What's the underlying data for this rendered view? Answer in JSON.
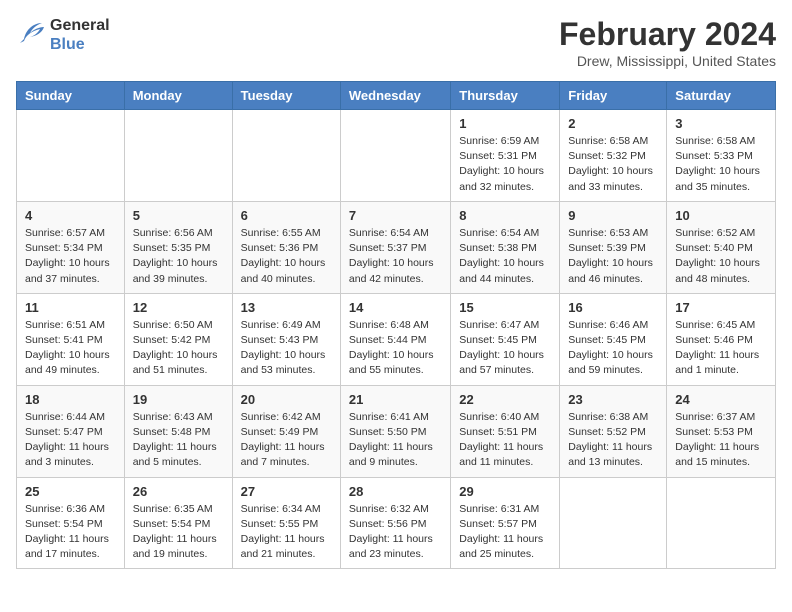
{
  "header": {
    "logo": {
      "general": "General",
      "blue": "Blue"
    },
    "title": "February 2024",
    "location": "Drew, Mississippi, United States"
  },
  "days_of_week": [
    "Sunday",
    "Monday",
    "Tuesday",
    "Wednesday",
    "Thursday",
    "Friday",
    "Saturday"
  ],
  "weeks": [
    [
      null,
      null,
      null,
      null,
      {
        "day": "1",
        "sunrise": "Sunrise: 6:59 AM",
        "sunset": "Sunset: 5:31 PM",
        "daylight": "Daylight: 10 hours and 32 minutes."
      },
      {
        "day": "2",
        "sunrise": "Sunrise: 6:58 AM",
        "sunset": "Sunset: 5:32 PM",
        "daylight": "Daylight: 10 hours and 33 minutes."
      },
      {
        "day": "3",
        "sunrise": "Sunrise: 6:58 AM",
        "sunset": "Sunset: 5:33 PM",
        "daylight": "Daylight: 10 hours and 35 minutes."
      }
    ],
    [
      {
        "day": "4",
        "sunrise": "Sunrise: 6:57 AM",
        "sunset": "Sunset: 5:34 PM",
        "daylight": "Daylight: 10 hours and 37 minutes."
      },
      {
        "day": "5",
        "sunrise": "Sunrise: 6:56 AM",
        "sunset": "Sunset: 5:35 PM",
        "daylight": "Daylight: 10 hours and 39 minutes."
      },
      {
        "day": "6",
        "sunrise": "Sunrise: 6:55 AM",
        "sunset": "Sunset: 5:36 PM",
        "daylight": "Daylight: 10 hours and 40 minutes."
      },
      {
        "day": "7",
        "sunrise": "Sunrise: 6:54 AM",
        "sunset": "Sunset: 5:37 PM",
        "daylight": "Daylight: 10 hours and 42 minutes."
      },
      {
        "day": "8",
        "sunrise": "Sunrise: 6:54 AM",
        "sunset": "Sunset: 5:38 PM",
        "daylight": "Daylight: 10 hours and 44 minutes."
      },
      {
        "day": "9",
        "sunrise": "Sunrise: 6:53 AM",
        "sunset": "Sunset: 5:39 PM",
        "daylight": "Daylight: 10 hours and 46 minutes."
      },
      {
        "day": "10",
        "sunrise": "Sunrise: 6:52 AM",
        "sunset": "Sunset: 5:40 PM",
        "daylight": "Daylight: 10 hours and 48 minutes."
      }
    ],
    [
      {
        "day": "11",
        "sunrise": "Sunrise: 6:51 AM",
        "sunset": "Sunset: 5:41 PM",
        "daylight": "Daylight: 10 hours and 49 minutes."
      },
      {
        "day": "12",
        "sunrise": "Sunrise: 6:50 AM",
        "sunset": "Sunset: 5:42 PM",
        "daylight": "Daylight: 10 hours and 51 minutes."
      },
      {
        "day": "13",
        "sunrise": "Sunrise: 6:49 AM",
        "sunset": "Sunset: 5:43 PM",
        "daylight": "Daylight: 10 hours and 53 minutes."
      },
      {
        "day": "14",
        "sunrise": "Sunrise: 6:48 AM",
        "sunset": "Sunset: 5:44 PM",
        "daylight": "Daylight: 10 hours and 55 minutes."
      },
      {
        "day": "15",
        "sunrise": "Sunrise: 6:47 AM",
        "sunset": "Sunset: 5:45 PM",
        "daylight": "Daylight: 10 hours and 57 minutes."
      },
      {
        "day": "16",
        "sunrise": "Sunrise: 6:46 AM",
        "sunset": "Sunset: 5:45 PM",
        "daylight": "Daylight: 10 hours and 59 minutes."
      },
      {
        "day": "17",
        "sunrise": "Sunrise: 6:45 AM",
        "sunset": "Sunset: 5:46 PM",
        "daylight": "Daylight: 11 hours and 1 minute."
      }
    ],
    [
      {
        "day": "18",
        "sunrise": "Sunrise: 6:44 AM",
        "sunset": "Sunset: 5:47 PM",
        "daylight": "Daylight: 11 hours and 3 minutes."
      },
      {
        "day": "19",
        "sunrise": "Sunrise: 6:43 AM",
        "sunset": "Sunset: 5:48 PM",
        "daylight": "Daylight: 11 hours and 5 minutes."
      },
      {
        "day": "20",
        "sunrise": "Sunrise: 6:42 AM",
        "sunset": "Sunset: 5:49 PM",
        "daylight": "Daylight: 11 hours and 7 minutes."
      },
      {
        "day": "21",
        "sunrise": "Sunrise: 6:41 AM",
        "sunset": "Sunset: 5:50 PM",
        "daylight": "Daylight: 11 hours and 9 minutes."
      },
      {
        "day": "22",
        "sunrise": "Sunrise: 6:40 AM",
        "sunset": "Sunset: 5:51 PM",
        "daylight": "Daylight: 11 hours and 11 minutes."
      },
      {
        "day": "23",
        "sunrise": "Sunrise: 6:38 AM",
        "sunset": "Sunset: 5:52 PM",
        "daylight": "Daylight: 11 hours and 13 minutes."
      },
      {
        "day": "24",
        "sunrise": "Sunrise: 6:37 AM",
        "sunset": "Sunset: 5:53 PM",
        "daylight": "Daylight: 11 hours and 15 minutes."
      }
    ],
    [
      {
        "day": "25",
        "sunrise": "Sunrise: 6:36 AM",
        "sunset": "Sunset: 5:54 PM",
        "daylight": "Daylight: 11 hours and 17 minutes."
      },
      {
        "day": "26",
        "sunrise": "Sunrise: 6:35 AM",
        "sunset": "Sunset: 5:54 PM",
        "daylight": "Daylight: 11 hours and 19 minutes."
      },
      {
        "day": "27",
        "sunrise": "Sunrise: 6:34 AM",
        "sunset": "Sunset: 5:55 PM",
        "daylight": "Daylight: 11 hours and 21 minutes."
      },
      {
        "day": "28",
        "sunrise": "Sunrise: 6:32 AM",
        "sunset": "Sunset: 5:56 PM",
        "daylight": "Daylight: 11 hours and 23 minutes."
      },
      {
        "day": "29",
        "sunrise": "Sunrise: 6:31 AM",
        "sunset": "Sunset: 5:57 PM",
        "daylight": "Daylight: 11 hours and 25 minutes."
      },
      null,
      null
    ]
  ]
}
